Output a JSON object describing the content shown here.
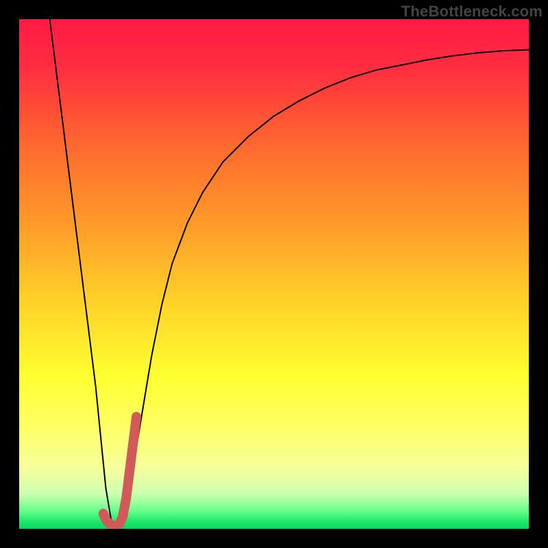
{
  "watermark": {
    "text": "TheBottleneck.com"
  },
  "gradient": {
    "stops": [
      {
        "offset": 0.0,
        "color": "#ff1a44"
      },
      {
        "offset": 0.1,
        "color": "#ff2f3f"
      },
      {
        "offset": 0.25,
        "color": "#ff6a2e"
      },
      {
        "offset": 0.4,
        "color": "#ff9a2a"
      },
      {
        "offset": 0.55,
        "color": "#ffd028"
      },
      {
        "offset": 0.7,
        "color": "#ffff30"
      },
      {
        "offset": 0.8,
        "color": "#ffff66"
      },
      {
        "offset": 0.88,
        "color": "#f6ff9a"
      },
      {
        "offset": 0.93,
        "color": "#cfffb0"
      },
      {
        "offset": 0.965,
        "color": "#66ff8a"
      },
      {
        "offset": 0.985,
        "color": "#20e86a"
      },
      {
        "offset": 1.0,
        "color": "#08d860"
      }
    ]
  },
  "chart_data": {
    "type": "line",
    "title": "",
    "xlabel": "",
    "ylabel": "",
    "xlim": [
      0,
      100
    ],
    "ylim": [
      0,
      100
    ],
    "series": [
      {
        "name": "black-curve",
        "color": "#000000",
        "stroke_width": 2,
        "x": [
          6,
          7,
          8,
          9,
          10,
          11,
          12,
          13,
          14,
          15,
          16,
          17,
          18,
          19,
          20,
          22,
          24,
          26,
          28,
          30,
          33,
          36,
          40,
          45,
          50,
          55,
          60,
          65,
          70,
          75,
          80,
          85,
          90,
          95,
          100
        ],
        "y": [
          100,
          92,
          84,
          76,
          68,
          60,
          52,
          44,
          36,
          28,
          18,
          8,
          2,
          0,
          2,
          10,
          22,
          34,
          44,
          52,
          60,
          66,
          72,
          77,
          81,
          84,
          86.5,
          88.5,
          90,
          91,
          92,
          92.8,
          93.4,
          93.8,
          94
        ]
      },
      {
        "name": "red-accent",
        "color": "#d05a5a",
        "stroke_width": 14,
        "linecap": "round",
        "x": [
          16.5,
          17.0,
          17.7,
          18.3,
          19.0,
          19.7,
          20.3,
          21.0,
          21.5,
          22.0,
          22.5,
          23.0
        ],
        "y": [
          3.0,
          1.8,
          1.0,
          0.6,
          0.6,
          1.0,
          2.4,
          6.0,
          10.0,
          14.0,
          18.0,
          22.0
        ]
      }
    ]
  }
}
